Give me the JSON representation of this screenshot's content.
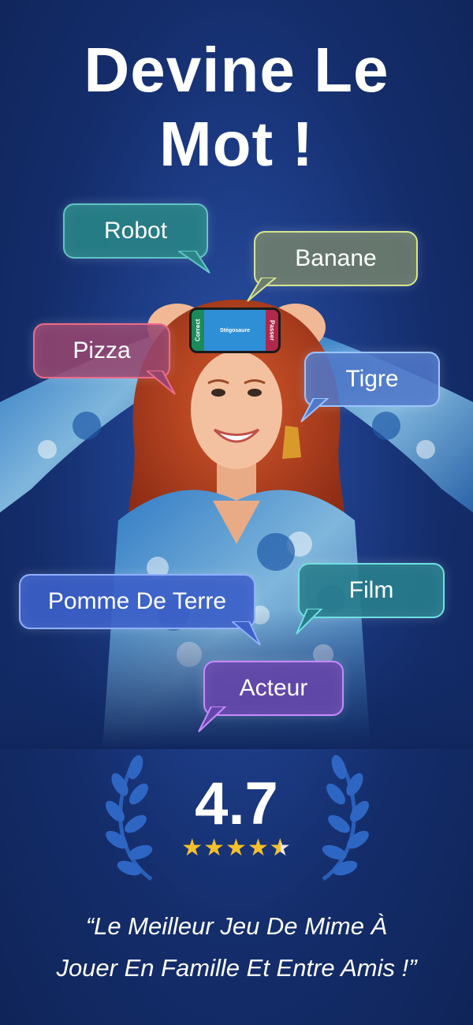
{
  "headline": {
    "line1": "Devine Le",
    "line2": "Mot !"
  },
  "bubbles": {
    "robot": "Robot",
    "banane": "Banane",
    "pizza": "Pizza",
    "tigre": "Tigre",
    "pomme": "Pomme De Terre",
    "film": "Film",
    "acteur": "Acteur"
  },
  "phone": {
    "left": "Correct",
    "word": "Stégosaure",
    "right": "Passer"
  },
  "rating": {
    "value": "4.7",
    "stars": 4.5,
    "star_color": "#f5c02a"
  },
  "quote": {
    "line1": "“Le Meilleur Jeu De Mime À",
    "line2": "Jouer En Famille Et Entre Amis !”"
  },
  "colors": {
    "background": "#1d3c86",
    "text": "#ffffff"
  }
}
